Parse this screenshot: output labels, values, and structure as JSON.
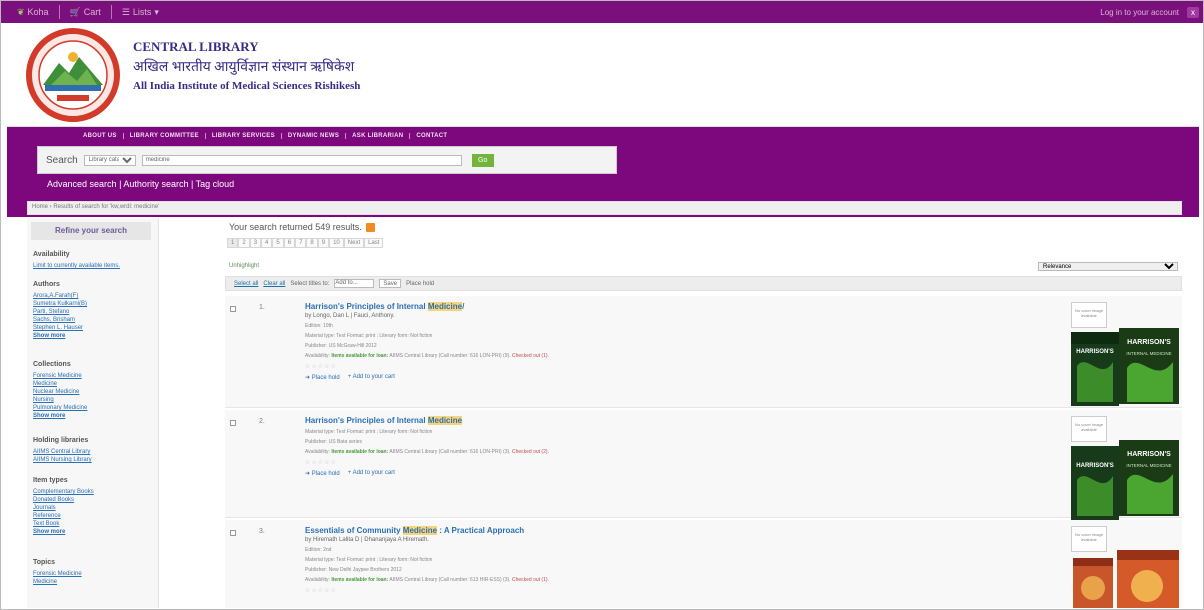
{
  "topbar": {
    "brand": "Koha",
    "cart": "Cart",
    "lists": "Lists",
    "login": "Log in to your account",
    "badge": "x"
  },
  "header": {
    "line1": "CENTRAL LIBRARY",
    "line2": "अखिल भारतीय आयुर्विज्ञान संस्थान ऋषिकेश",
    "line3": "All India Institute of Medical Sciences Rishikesh"
  },
  "nav": {
    "links": [
      "ABOUT US",
      "LIBRARY COMMITTEE",
      "LIBRARY SERVICES",
      "DYNAMIC NEWS",
      "ASK LIBRARIAN",
      "CONTACT"
    ],
    "search_label": "Search",
    "search_scope": "Library catalog",
    "search_value": "medicine",
    "go": "Go",
    "advanced": "Advanced search",
    "authority": "Authority search",
    "tagcloud": "Tag cloud",
    "sep": "|"
  },
  "breadcrumb": "Home › Results of search for 'kw,wrdl: medicine'",
  "sidebar": {
    "refine": "Refine your search",
    "availability": {
      "heading": "Availability",
      "link": "Limit to currently available items."
    },
    "authors": {
      "heading": "Authors",
      "items": [
        "Arora,A.Farah(F)",
        "Sumetra Kulkarni(B)",
        "Parti, Stefano",
        "Sachs, Brisham",
        "Stephen L. Hauser"
      ],
      "more": "Show more"
    },
    "collections": {
      "heading": "Collections",
      "items": [
        "Forensic Medicine",
        "Medicine",
        "Nuclear Medicine",
        "Nursing",
        "Pulmonary Medicine"
      ],
      "more": "Show more"
    },
    "holding": {
      "heading": "Holding libraries",
      "items": [
        "AIIMS Central Library",
        "AIIMS Nursing Library"
      ]
    },
    "itemtypes": {
      "heading": "Item types",
      "items": [
        "Complementary Books",
        "Donated Books",
        "Journals",
        "Reference",
        "Text Book"
      ],
      "more": "Show more"
    },
    "topics": {
      "heading": "Topics",
      "items": [
        "Forensic Medicine",
        "Medicine"
      ]
    }
  },
  "main": {
    "result_count": "Your search returned 549 results.",
    "pages": [
      "1",
      "2",
      "3",
      "4",
      "5",
      "6",
      "7",
      "8",
      "9",
      "10",
      "Next",
      "Last"
    ],
    "unhighlight": "Unhighlight",
    "sort": "Relevance",
    "select_all": "Select all",
    "clear_all": "Clear all",
    "select_titles": "Select titles to:",
    "add_to": "Add to...",
    "save": "Save",
    "place_hold": "Place hold"
  },
  "results": [
    {
      "num": "1.",
      "title_pre": "Harrison's Principles of Internal ",
      "title_hl": "Medicine",
      "title_post": "/",
      "by": "by Longo, Dan L | Fauci, Anthony.",
      "edition": "Edition: 19th",
      "material": "Material type: Text Format: print ; Literary form: Not fiction",
      "publisher": "Publisher: US McGraw-Hill 2012",
      "availability_label": "Availability:",
      "availability_green": "Items available for loan:",
      "availability_text": "AIIMS Central Library (Call number: 616 LON-PRI) (9).",
      "availability_red": "Checked out (1).",
      "stars": "☆☆☆☆☆",
      "place_hold": "Place hold",
      "add_cart": "Add to your cart",
      "nocover": "No cover image available",
      "cover_title": "HARRISON'S",
      "cover_sub": "INTERNAL MEDICINE"
    },
    {
      "num": "2.",
      "title_pre": "Harrison's Principles of Internal ",
      "title_hl": "Medicine",
      "title_post": "",
      "by": "",
      "edition": "",
      "material": "Material type: Text Format: print ; Literary form: Not fiction",
      "publisher": "Publisher: US Bata series",
      "availability_label": "Availability:",
      "availability_green": "Items available for loan:",
      "availability_text": "AIIMS Central Library (Call number: 616 LON-PRI) (3).",
      "availability_red": "Checked out (2).",
      "stars": "☆☆☆☆☆",
      "place_hold": "Place hold",
      "add_cart": "Add to your cart",
      "nocover": "No cover image available",
      "cover_title": "HARRISON'S",
      "cover_sub": "INTERNAL MEDICINE"
    },
    {
      "num": "3.",
      "title_pre": "Essentials of Community ",
      "title_hl": "Medicine",
      "title_post": " : A Practical Approach",
      "by": "by Hiremath Lalita D | Dhananjaya A Hiremath.",
      "edition": "Edition: 2nd",
      "material": "Material type: Text Format: print ; Literary form: Not fiction",
      "publisher": "Publisher: New Delhi Jaypee Brothers 2012",
      "availability_label": "Availability:",
      "availability_green": "Items available for loan:",
      "availability_text": "AIIMS Central Library (Call number: 613 HIR-ESS) (3).",
      "availability_red": "Checked out (1).",
      "stars": "☆☆☆☆☆",
      "place_hold": "Place hold",
      "add_cart": "Add to your cart",
      "nocover": "No cover image available",
      "cover_title": "",
      "cover_sub": ""
    }
  ],
  "colors": {
    "purple": "#7d087d",
    "link": "#2b6fb5",
    "go": "#72b53b",
    "highlight": "#f6d47a"
  }
}
